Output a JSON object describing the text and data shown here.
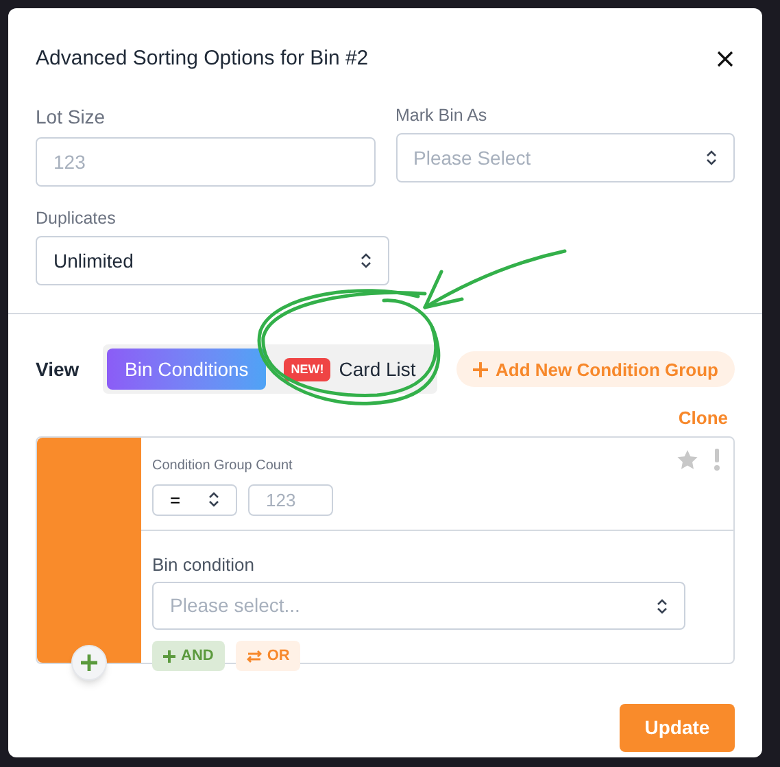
{
  "dialog": {
    "title": "Advanced Sorting Options for Bin #2"
  },
  "fields": [
    {
      "kind": "input",
      "label": "Lot Size",
      "placeholder": "123"
    },
    {
      "kind": "select",
      "label": "Mark Bin As",
      "placeholder": "Please Select"
    },
    {
      "kind": "select",
      "label": "Duplicates",
      "value": "Unlimited"
    }
  ],
  "view": {
    "label": "View",
    "tabs": [
      {
        "label": "Bin Conditions",
        "selected": true
      },
      {
        "label": "Card List",
        "badge": "NEW!",
        "selected": false
      }
    ]
  },
  "add_group_button": "Add New Condition Group",
  "condition_group": {
    "clone": "Clone",
    "count_label": "Condition Group Count",
    "operator": "=",
    "count_placeholder": "123",
    "condition_label": "Bin condition",
    "condition_placeholder": "Please select...",
    "buttons": [
      {
        "kind": "and",
        "label": "AND"
      },
      {
        "kind": "or",
        "label": "OR"
      }
    ]
  },
  "update_button": "Update"
}
